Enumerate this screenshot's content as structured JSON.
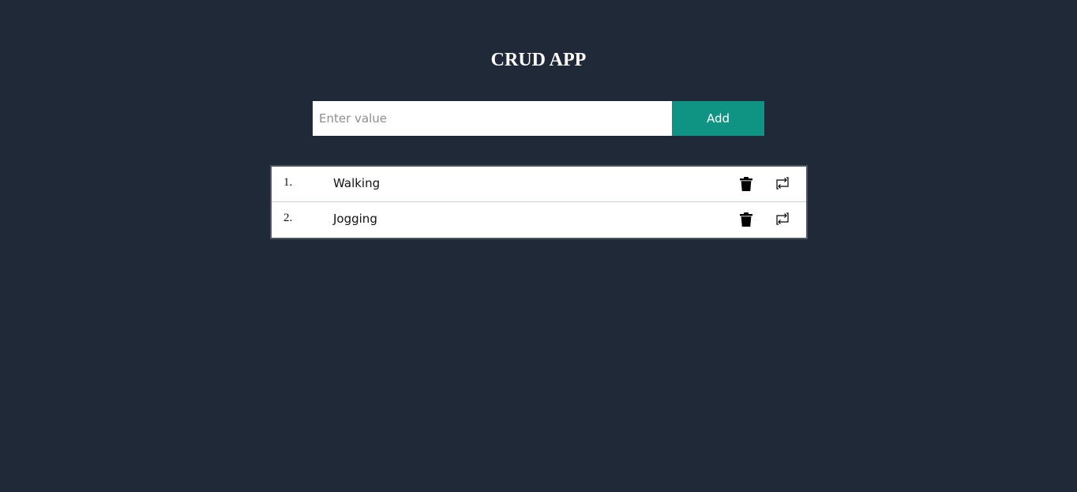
{
  "app": {
    "title": "CRUD APP",
    "background_color": "#202938"
  },
  "form": {
    "input_value": "",
    "input_placeholder": "Enter value",
    "add_label": "Add",
    "add_color": "#0f9484"
  },
  "items": [
    {
      "number": "1.",
      "text": "Walking",
      "delete_icon": "trash-icon",
      "update_icon": "refresh-icon"
    },
    {
      "number": "2.",
      "text": "Jogging",
      "delete_icon": "trash-icon",
      "update_icon": "refresh-icon"
    }
  ]
}
